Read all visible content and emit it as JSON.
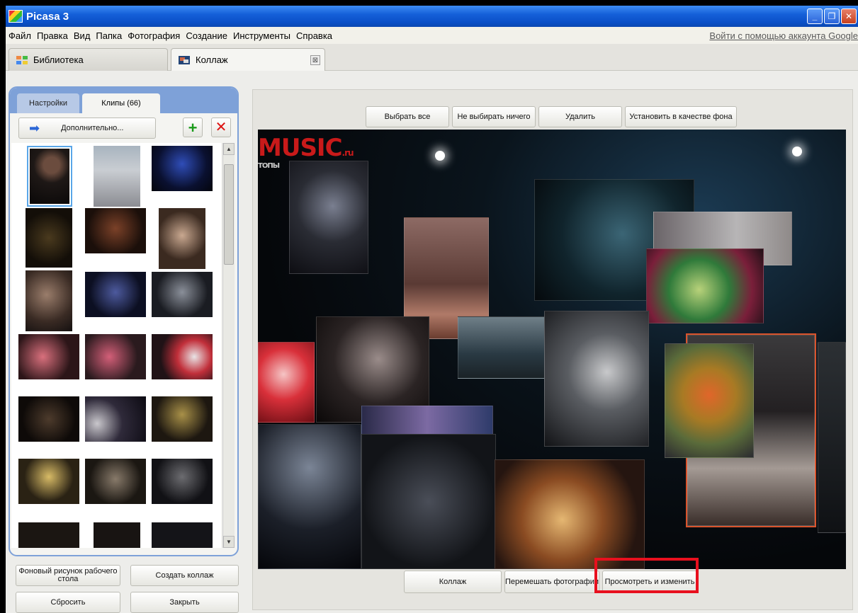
{
  "window": {
    "title": "Picasa 3",
    "buttons": {
      "minimize": "_",
      "maximize": "❐",
      "close": "✕"
    }
  },
  "menu": {
    "items": [
      "Файл",
      "Правка",
      "Вид",
      "Папка",
      "Фотография",
      "Создание",
      "Инструменты",
      "Справка"
    ],
    "signin": "Войти с помощью аккаунта Google"
  },
  "tabs": {
    "library": "Библиотека",
    "collage": "Коллаж",
    "close_glyph": "⊠"
  },
  "left_panel": {
    "tab_settings": "Настройки",
    "tab_clips": "Клипы (66)",
    "more_label": "Дополнительно...",
    "more_arrow": "➡",
    "add_glyph": "+",
    "remove_glyph": "✕",
    "scroll_up": "▲",
    "scroll_down": "▼",
    "buttons": {
      "desktop_bg": "Фоновый рисунок рабочего стола",
      "create": "Создать коллаж",
      "reset": "Сбросить",
      "close": "Закрыть"
    }
  },
  "toolbar": {
    "select_all": "Выбрать все",
    "select_none": "Не выбирать ничего",
    "delete": "Удалить",
    "set_background": "Установить в качестве фона"
  },
  "canvas": {
    "logo": "MUSIC",
    "logo_suffix": ".ru",
    "logo_sub": "ТОПЫ"
  },
  "bottom": {
    "collage": "Коллаж",
    "shuffle": "Перемешать фотографии",
    "preview": "Просмотреть и изменить"
  }
}
